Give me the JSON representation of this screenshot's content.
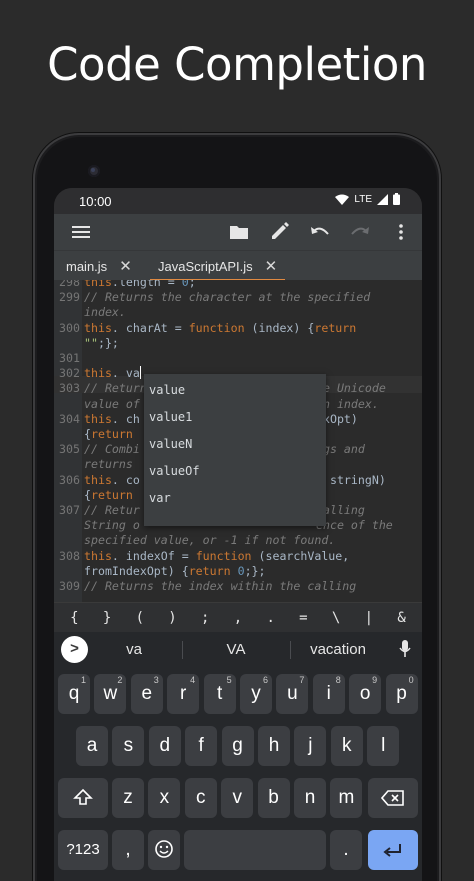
{
  "headline": "Code Completion",
  "status": {
    "time": "10:00",
    "network": "LTE"
  },
  "toolbar": {
    "icons": [
      "menu-icon",
      "folder-icon",
      "pencil-icon",
      "undo-icon",
      "redo-icon",
      "more-vert-icon"
    ]
  },
  "tabs": [
    {
      "label": "main.js",
      "close": "✕"
    },
    {
      "label": "JavaScriptAPI.js",
      "close": "✕"
    }
  ],
  "editor": {
    "lines": [
      {
        "n": "298",
        "code": "this.length = 0;"
      },
      {
        "n": "299",
        "code": "// Returns the character at the specified"
      },
      {
        "n": "",
        "code": "index."
      },
      {
        "n": "300",
        "code": "this. charAt = function (index) {return"
      },
      {
        "n": "",
        "code": "\"\";};"
      },
      {
        "n": "301",
        "code": ""
      },
      {
        "n": "302",
        "code": "this. va"
      },
      {
        "n": "303",
        "code": "// Return"
      },
      {
        "n": "",
        "code": "value of"
      },
      {
        "n": "304",
        "code": "this. ch"
      },
      {
        "n": "",
        "code": "{return"
      },
      {
        "n": "305",
        "code": "// Combi"
      },
      {
        "n": "",
        "code": "returns"
      },
      {
        "n": "306",
        "code": "this. co"
      },
      {
        "n": "",
        "code": "{return"
      },
      {
        "n": "307",
        "code": "// Retur"
      },
      {
        "n": "",
        "code": "String o"
      },
      {
        "n": "",
        "code": "specified value, or -1 if not found."
      },
      {
        "n": "308",
        "code": "this. indexOf = function (searchValue,"
      },
      {
        "n": "",
        "code": "fromIndexOpt) {return 0;};"
      },
      {
        "n": "309",
        "code": "// Returns the index within the calling"
      }
    ],
    "right_fragments": [
      "he Unicode",
      "en index.",
      "exOpt)",
      "ngs and",
      ", stringN)",
      "calling",
      "ence of the"
    ]
  },
  "completion": {
    "typed_prefix": "va",
    "items": [
      "value",
      "value1",
      "valueN",
      "valueOf",
      "var"
    ]
  },
  "symbols": [
    "{",
    "}",
    "(",
    ")",
    ";",
    ",",
    ".",
    "=",
    "\\",
    "|",
    "&"
  ],
  "keyboard": {
    "suggestions": [
      "va",
      "VA",
      "vacation"
    ],
    "row1": [
      {
        "k": "q",
        "h": "1"
      },
      {
        "k": "w",
        "h": "2"
      },
      {
        "k": "e",
        "h": "3"
      },
      {
        "k": "r",
        "h": "4"
      },
      {
        "k": "t",
        "h": "5"
      },
      {
        "k": "y",
        "h": "6"
      },
      {
        "k": "u",
        "h": "7"
      },
      {
        "k": "i",
        "h": "8"
      },
      {
        "k": "o",
        "h": "9"
      },
      {
        "k": "p",
        "h": "0"
      }
    ],
    "row2": [
      "a",
      "s",
      "d",
      "f",
      "g",
      "h",
      "j",
      "k",
      "l"
    ],
    "row3": [
      "z",
      "x",
      "c",
      "v",
      "b",
      "n",
      "m"
    ],
    "symbols_key": "?123",
    "comma_key": ",",
    "period_key": "."
  }
}
